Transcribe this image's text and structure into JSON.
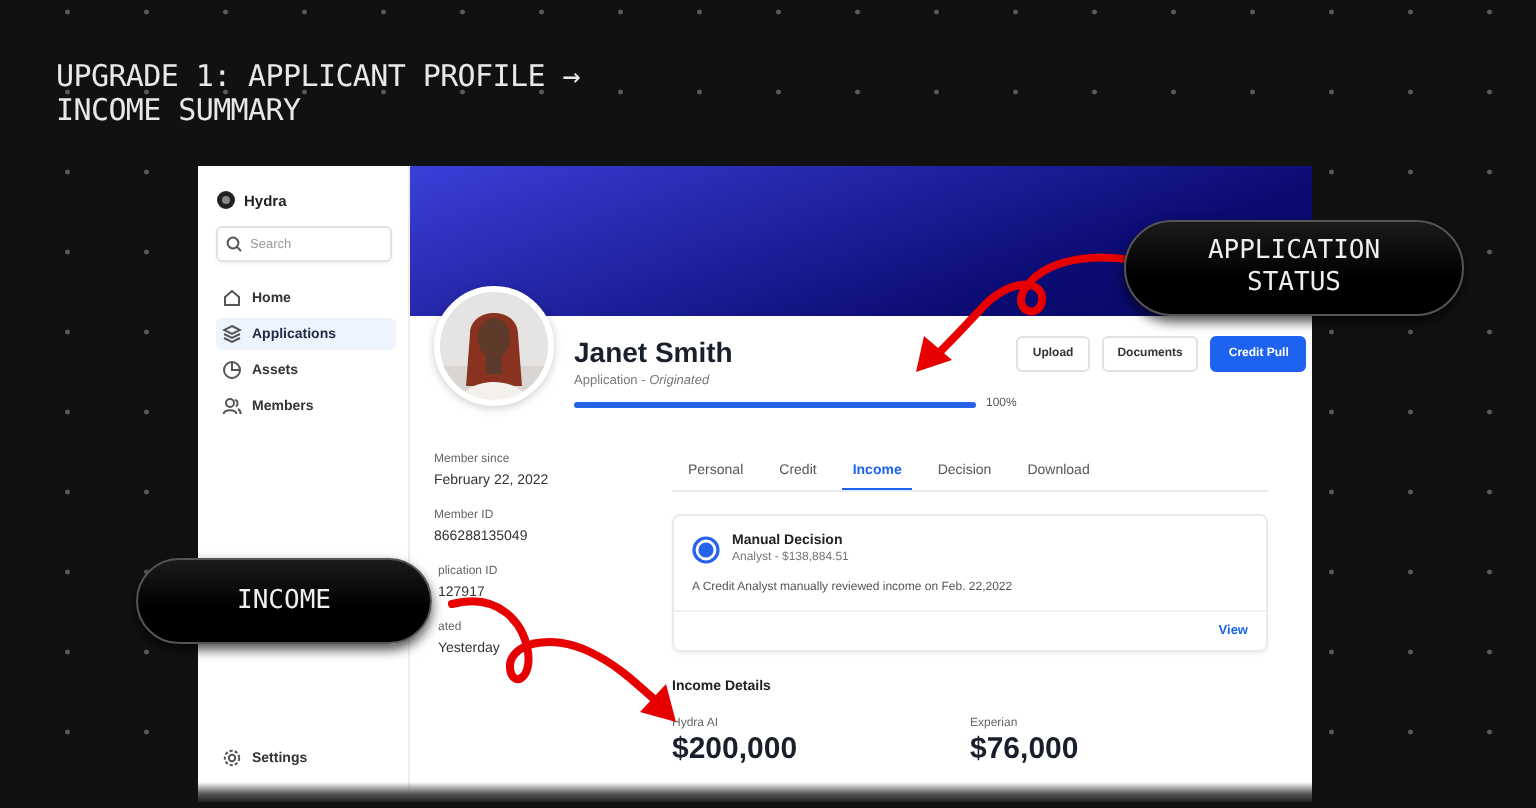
{
  "headline": "UPGRADE 1: APPLICANT PROFILE → INCOME SUMMARY",
  "callouts": [
    {
      "label": "APPLICATION STATUS",
      "kind": "status"
    },
    {
      "label": "INCOME",
      "kind": "income"
    }
  ],
  "sidebar": {
    "brand": "Hydra",
    "search": {
      "placeholder": "Search"
    },
    "items": [
      {
        "label": "Home",
        "selected": false
      },
      {
        "label": "Applications",
        "selected": true
      },
      {
        "label": "Assets",
        "selected": false
      },
      {
        "label": "Members",
        "selected": false
      }
    ],
    "footer_item": {
      "label": "Settings"
    }
  },
  "profile": {
    "name": "Janet Smith",
    "status_label": "Application - *Originated*",
    "progress": {
      "level": 1,
      "reading": "100%"
    },
    "buttons": [
      {
        "label": "Upload",
        "primary": false
      },
      {
        "label": "Documents",
        "primary": false
      },
      {
        "label": "Credit Pull",
        "primary": true
      }
    ]
  },
  "details": [
    {
      "label": "Member since",
      "value": "February 22, 2022"
    },
    {
      "label": "Member ID",
      "value": "866288135049"
    },
    {
      "label": "plication ID",
      "value": "127917"
    },
    {
      "label": "ated",
      "value": "Yesterday"
    }
  ],
  "tabs": [
    {
      "label": "Personal",
      "selected": false
    },
    {
      "label": "Credit",
      "selected": false
    },
    {
      "label": "Income",
      "selected": true
    },
    {
      "label": "Decision",
      "selected": false
    },
    {
      "label": "Download",
      "selected": false
    }
  ],
  "decision_card": {
    "title": "Manual Decision",
    "subtitle": "Analyst - $138,884.51",
    "note": "A Credit Analyst manually reviewed income on Feb. 22,2022",
    "link": "View"
  },
  "income_details": {
    "title": "Income Details",
    "sources": [
      {
        "label": "Hydra AI",
        "amount": "$200,000"
      },
      {
        "label": "Experian",
        "amount": "$76,000"
      }
    ]
  }
}
